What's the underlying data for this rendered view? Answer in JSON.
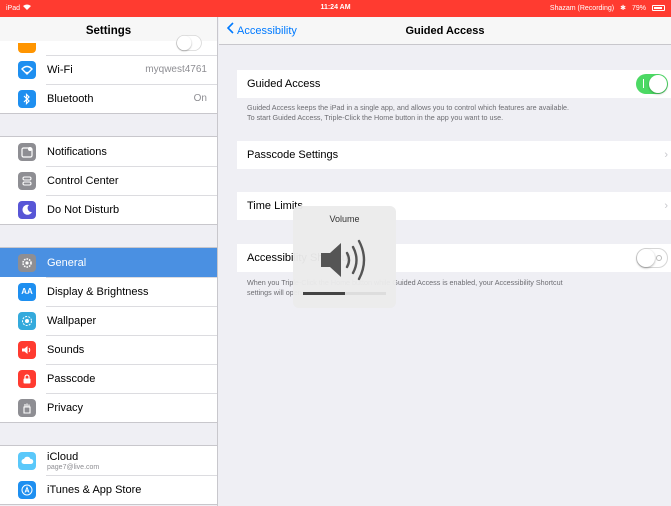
{
  "status": {
    "device": "iPad",
    "time": "11:24 AM",
    "recording": "Shazam (Recording)",
    "battery": "79%"
  },
  "sidebar": {
    "title": "Settings",
    "wifi": {
      "label": "Wi-Fi",
      "value": "myqwest4761"
    },
    "bluetooth": {
      "label": "Bluetooth",
      "value": "On"
    },
    "notifications": "Notifications",
    "control_center": "Control Center",
    "dnd": "Do Not Disturb",
    "general": "General",
    "display": "Display & Brightness",
    "wallpaper": "Wallpaper",
    "sounds": "Sounds",
    "passcode": "Passcode",
    "privacy": "Privacy",
    "icloud": {
      "label": "iCloud",
      "sub": "page7@live.com"
    },
    "itunes": "iTunes & App Store",
    "colors": {
      "wifi": "#1e8ff0",
      "bluetooth": "#1e8ff0",
      "notifications": "#8e8e93",
      "control_center": "#8e8e93",
      "dnd": "#5856d6",
      "general": "#8e8e93",
      "display": "#1e8ff0",
      "wallpaper": "#34aadc",
      "sounds": "#ff3b30",
      "passcode": "#ff3b30",
      "privacy": "#8e8e93",
      "icloud": "#5ac8fa",
      "itunes": "#1e8ff0",
      "selected": "#4a90e2"
    }
  },
  "nav": {
    "back": "Accessibility",
    "title": "Guided Access"
  },
  "content": {
    "guided_access_label": "Guided Access",
    "guided_access_on": true,
    "guided_access_desc_1": "Guided Access keeps the iPad in a single app, and allows you to control which features are available.",
    "guided_access_desc_2": "To start Guided Access, Triple-Click the Home button in the app you want to use.",
    "passcode_settings": "Passcode Settings",
    "time_limits": "Time Limits",
    "accessibility_shortcut": "Accessibility Shortcut",
    "shortcut_on": false,
    "shortcut_desc_1": "When you Triple-Click the Home button while Guided Access is enabled, your Accessibility Shortcut",
    "shortcut_desc_2": "settings will open."
  },
  "hud": {
    "title": "Volume",
    "level": 0.5
  },
  "accent": "#007aff",
  "toggle_on_color": "#4cd964"
}
